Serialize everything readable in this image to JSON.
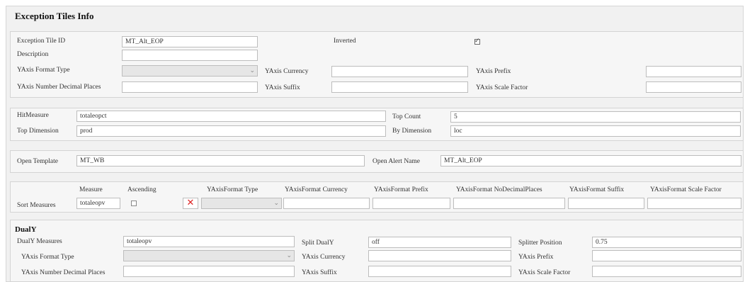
{
  "title": "Exception Tiles Info",
  "tile": {
    "id_label": "Exception Tile ID",
    "id_value": "MT_Alt_EOP",
    "inverted_label": "Inverted",
    "inverted_checked": true,
    "description_label": "Description",
    "description_value": "",
    "yaxis_format_type_label": "YAxis Format Type",
    "yaxis_currency_label": "YAxis Currency",
    "yaxis_prefix_label": "YAxis Prefix",
    "yaxis_decimal_label": "YAxis Number Decimal Places",
    "yaxis_suffix_label": "YAxis Suffix",
    "yaxis_scale_label": "YAxis Scale Factor"
  },
  "measure": {
    "hitmeasure_label": "HitMeasure",
    "hitmeasure_value": "totaleopct",
    "topcount_label": "Top Count",
    "topcount_value": "5",
    "topdimension_label": "Top Dimension",
    "topdimension_value": "prod",
    "bydimension_label": "By Dimension",
    "bydimension_value": "loc"
  },
  "templates": {
    "open_template_label": "Open Template",
    "open_template_value": "MT_WB",
    "open_alert_label": "Open Alert Name",
    "open_alert_value": "MT_Alt_EOP"
  },
  "sort": {
    "row_label": "Sort Measures",
    "headers": {
      "measure": "Measure",
      "ascending": "Ascending",
      "format_type": "YAxisFormat Type",
      "format_currency": "YAxisFormat Currency",
      "format_prefix": "YAxisFormat Prefix",
      "format_decimal": "YAxisFormat NoDecimalPlaces",
      "format_suffix": "YAxisFormat Suffix",
      "format_scale": "YAxisFormat Scale Factor"
    },
    "measure_value": "totaleopv",
    "ascending_checked": false
  },
  "dualy": {
    "title": "DualY",
    "measures_label": "DualY Measures",
    "measures_value": "totaleopv",
    "split_label": "Split DualY",
    "split_value": "off",
    "splitter_label": "Splitter Position",
    "splitter_value": "0.75",
    "format_type_label": "YAxis Format Type",
    "currency_label": "YAxis Currency",
    "prefix_label": "YAxis Prefix",
    "decimal_label": "YAxis Number Decimal Places",
    "suffix_label": "YAxis Suffix",
    "scale_label": "YAxis Scale Factor"
  },
  "icons": {
    "remove": "remove-x-icon",
    "dropdown": "chevron-down-icon",
    "checkbox": "checkbox-icon"
  },
  "colors": {
    "remove_icon": "#d22222",
    "panel_bg": "#f6f6f6",
    "outer_bg": "#f1f1f1"
  }
}
